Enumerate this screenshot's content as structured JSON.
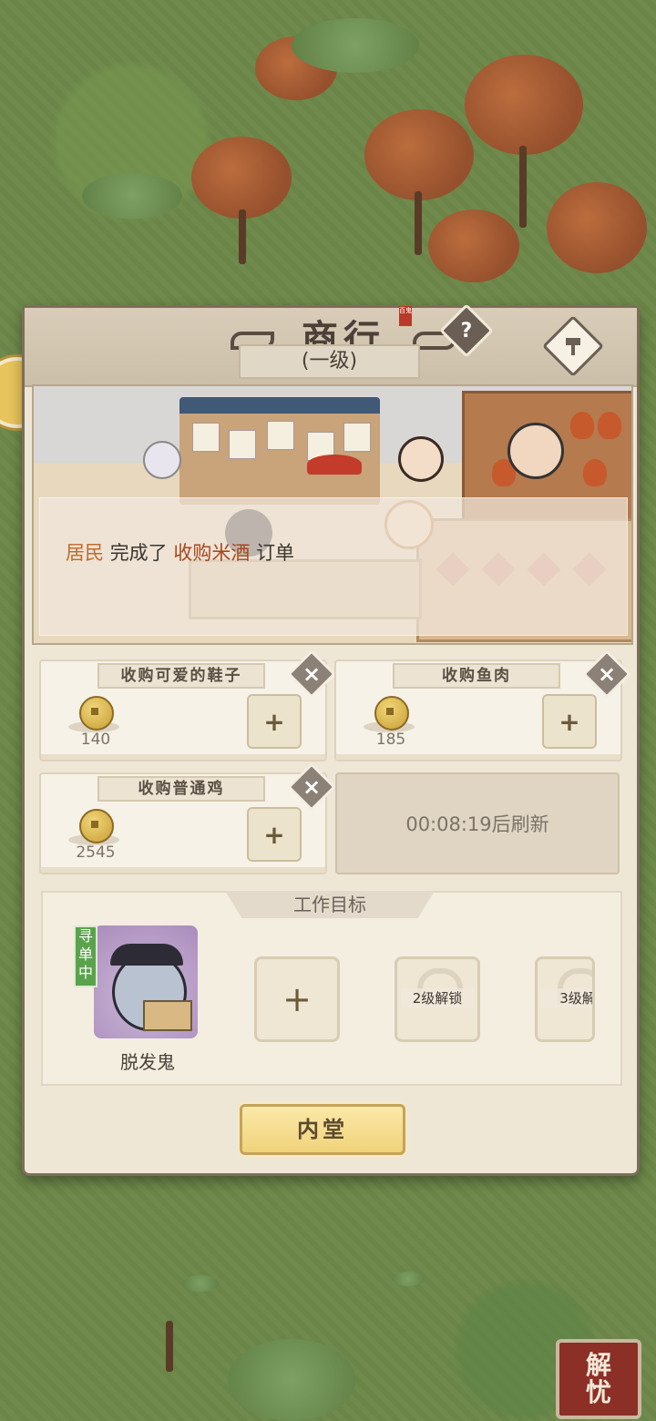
{
  "header": {
    "title": "商行",
    "seal_text": "百鬼",
    "level": "(一级)",
    "help_icon": "question-icon",
    "build_icon": "hammer-icon"
  },
  "banner": {
    "actor": "居民",
    "action": "完成了",
    "item": "收购米酒",
    "suffix": "订单"
  },
  "orders": [
    {
      "title": "收购可爱的鞋子",
      "price": "140"
    },
    {
      "title": "收购鱼肉",
      "price": "185"
    },
    {
      "title": "收购普通鸡",
      "price": "2545"
    }
  ],
  "refresh": {
    "text": "00:08:19后刷新"
  },
  "work": {
    "header": "工作目标",
    "worker_name": "脱发鬼",
    "worker_status": "寻单中",
    "slots": [
      {
        "type": "add",
        "label": "+"
      },
      {
        "type": "locked",
        "label": "2级解锁"
      },
      {
        "type": "locked",
        "label": "3级解"
      }
    ]
  },
  "buttons": {
    "inner_hall": "内堂",
    "add_label": "+",
    "close_label": "×"
  },
  "corner": {
    "top_char": "解",
    "bottom_char": "忧"
  },
  "colors": {
    "highlight_actor": "#c06a2e",
    "highlight_item": "#a8471e",
    "status_green": "#5aa34c",
    "accent_gold": "#f0d27a"
  }
}
